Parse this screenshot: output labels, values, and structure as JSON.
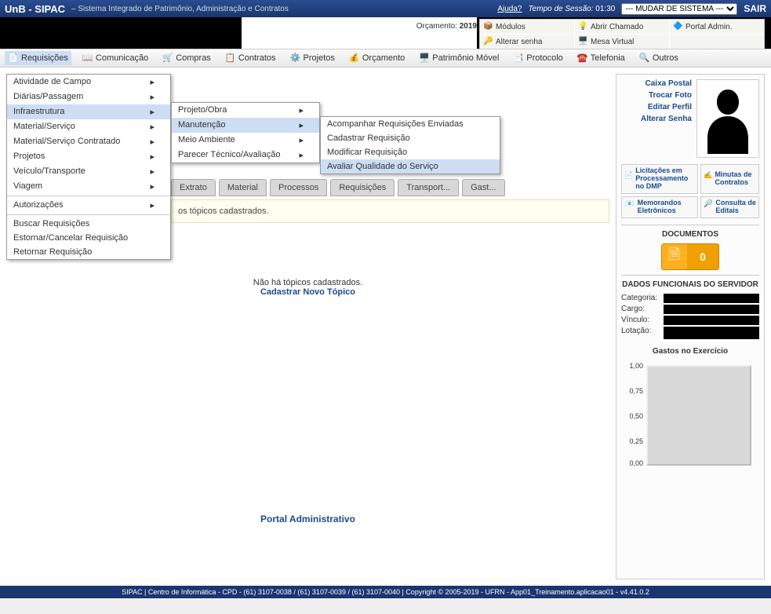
{
  "topbar": {
    "title": "UnB - SIPAC",
    "subtitle": "– Sistema Integrado de Patrimônio, Administração e Contratos",
    "help": "Ajuda?",
    "session_label": "Tempo de Sessão:",
    "session_time": "01:30",
    "system_switch": "--- MUDAR DE SISTEMA ---",
    "exit": "SAIR"
  },
  "orcamento": {
    "label": "Orçamento:",
    "year": "2019"
  },
  "quicklinks": {
    "modulos": "Módulos",
    "abrir_chamado": "Abrir Chamado",
    "portal_admin": "Portal Admin.",
    "alterar_senha": "Alterar senha",
    "mesa_virtual": "Mesa Virtual"
  },
  "menubar": {
    "requisicoes": "Requisições",
    "comunicacao": "Comunicação",
    "compras": "Compras",
    "contratos": "Contratos",
    "projetos": "Projetos",
    "orcamento": "Orçamento",
    "patrimonio": "Patrimônio Móvel",
    "protocolo": "Protocolo",
    "telefonia": "Telefonia",
    "outros": "Outros"
  },
  "dropdown1": {
    "items": [
      "Atividade de Campo",
      "Diárias/Passagem",
      "Infraestrutura",
      "Material/Serviço",
      "Material/Serviço Contratado",
      "Projetos",
      "Veículo/Transporte",
      "Viagem",
      "Autorizações",
      "Buscar Requisições",
      "Estornar/Cancelar Requisição",
      "Retornar Requisição"
    ]
  },
  "dropdown2": {
    "items": [
      "Projeto/Obra",
      "Manutenção",
      "Meio Ambiente",
      "Parecer Técnico/Avaliação"
    ]
  },
  "dropdown3": {
    "items": [
      "Acompanhar Requisições Enviadas",
      "Cadastrar Requisição",
      "Modificar Requisição",
      "Avaliar Qualidade do Serviço"
    ]
  },
  "tabs": [
    "Extrato",
    "Material",
    "Processos",
    "Requisições",
    "Transport...",
    "Gast..."
  ],
  "msgbox_text": "os tópicos cadastrados.",
  "center": {
    "msg": "Não há tópicos cadastrados.",
    "link": "Cadastrar Novo Tópico"
  },
  "portal_label": "Portal Administrativo",
  "sidebar": {
    "profile_links": [
      "Caixa Postal",
      "Trocar Foto",
      "Editar Perfil",
      "Alterar Senha"
    ],
    "buttons": [
      {
        "line1": "Licitações em",
        "line2": "Processamento no DMP"
      },
      {
        "line1": "Minutas de",
        "line2": "Contratos"
      },
      {
        "line1": "Memorandos",
        "line2": "Eletrônicos"
      },
      {
        "line1": "Consulta de",
        "line2": "Editais"
      }
    ],
    "documentos_title": "DOCUMENTOS",
    "doc_count": "0",
    "dados_title": "DADOS FUNCIONAIS DO SERVIDOR",
    "dados": {
      "categoria": "Categoria:",
      "cargo": "Cargo:",
      "vinculo": "Vínculo:",
      "lotacao": "Lotação:"
    },
    "chart_title": "Gastos no Exercício"
  },
  "chart_data": {
    "type": "bar",
    "title": "Gastos no Exercício",
    "categories": [],
    "values": [],
    "ylim": [
      0,
      1
    ],
    "yticks": [
      0.0,
      0.25,
      0.5,
      0.75,
      1.0
    ],
    "xlabel": "",
    "ylabel": ""
  },
  "footer": "SIPAC | Centro de Informática - CPD - (61) 3107-0038 / (61) 3107-0039 / (61) 3107-0040 | Copyright © 2005-2019 - UFRN - App01_Treinamento.aplicacao01 - v4.41.0.2"
}
